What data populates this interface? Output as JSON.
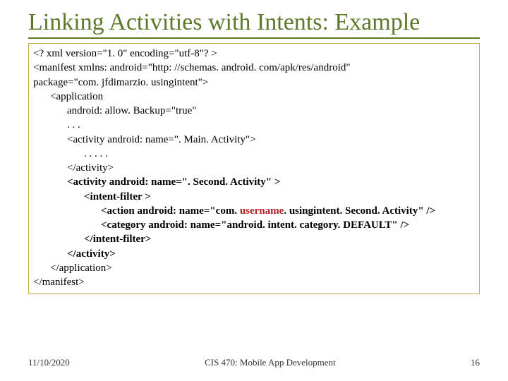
{
  "title": "Linking Activities with Intents: Example",
  "code": {
    "l1": "<? xml version=\"1. 0\" encoding=\"utf-8\"? >",
    "l2": "<manifest xmlns: android=\"http: //schemas. android. com/apk/res/android\"",
    "l3": "package=\"com. jfdimarzio. usingintent\">",
    "l4": "<application",
    "l5": "android: allow. Backup=\"true\"",
    "l6": ". . .",
    "l7": "<activity android: name=\". Main. Activity\">",
    "l8": ". . . . .",
    "l9": "</activity>",
    "l10a": "<activity android: name=\". Second. Activity\" >",
    "l11": "<intent-filter >",
    "l12a": "<action android: name=\"com. ",
    "l12u": "username",
    "l12b": ". usingintent. Second. Activity\" />",
    "l13": "<category android: name=\"android. intent. category. DEFAULT\" />",
    "l14": "</intent-filter>",
    "l15": "</activity>",
    "l16": "</application>",
    "l17": "</manifest>"
  },
  "footer": {
    "date": "11/10/2020",
    "course": "CIS 470: Mobile App Development",
    "page": "16"
  }
}
